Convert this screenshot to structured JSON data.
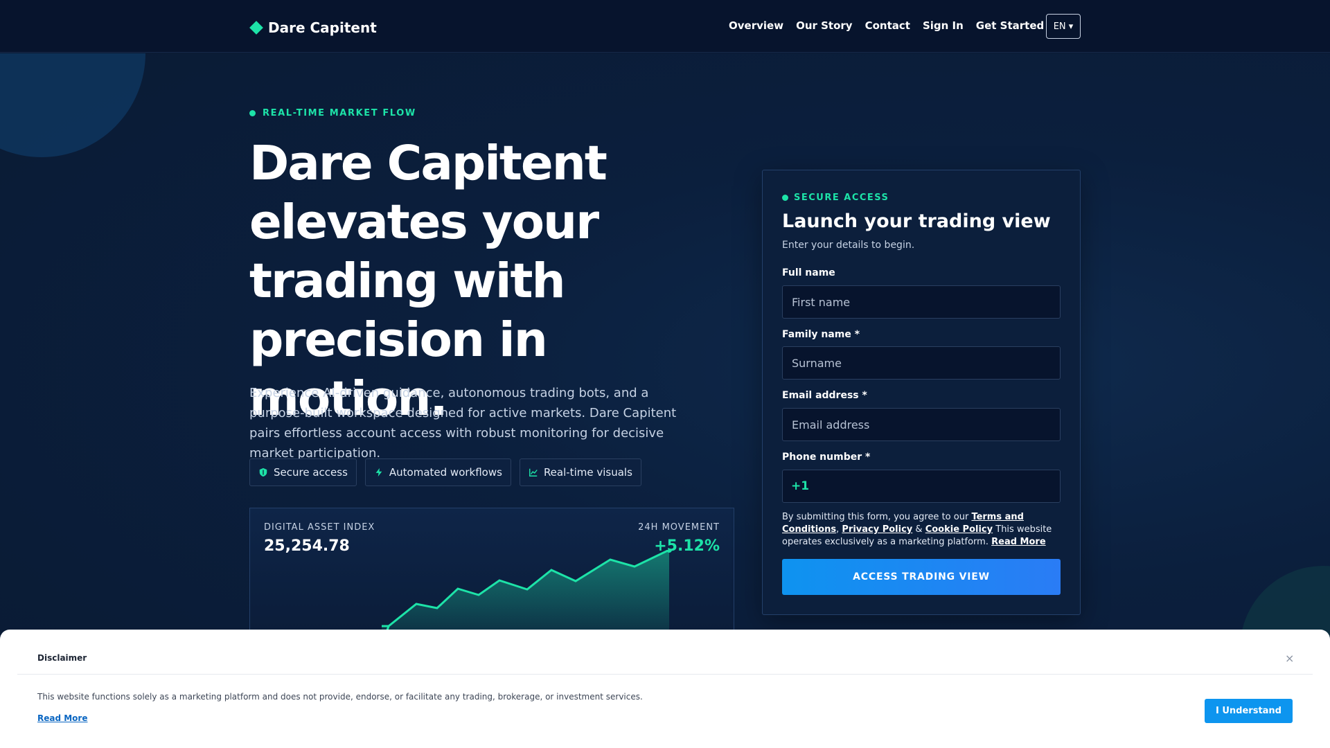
{
  "nav": {
    "brand": "Dare Capitent",
    "links": [
      "Overview",
      "Our Story",
      "Contact",
      "Sign In",
      "Get Started"
    ],
    "language": "EN ▾"
  },
  "hero": {
    "eyebrow": "REAL-TIME MARKET FLOW",
    "headline": "Dare Capitent elevates your trading with precision in motion.",
    "lead": "Experience AI-driven guidance, autonomous trading bots, and a purpose-built workspace designed for active markets. Dare Capitent pairs effortless account access with robust monitoring for decisive market participation.",
    "chips": [
      "Secure access",
      "Automated workflows",
      "Real-time visuals"
    ]
  },
  "index_card": {
    "label": "DIGITAL ASSET INDEX",
    "value": "25,254.78",
    "movement_label": "24H MOVEMENT",
    "movement_value": "+5.12%",
    "accent": "#1de3a8"
  },
  "form": {
    "eyebrow": "SECURE ACCESS",
    "title": "Launch your trading view",
    "subtitle": "Enter your details to begin.",
    "full_name_label": "Full name",
    "full_name_placeholder": "First name",
    "family_name_label": "Family name *",
    "family_name_placeholder": "Surname",
    "email_label": "Email address *",
    "email_placeholder": "Email address",
    "phone_label": "Phone number *",
    "phone_code": "+1",
    "legal_prefix": "By submitting this form, you agree to our",
    "terms": "Terms and Conditions",
    "comma": ",",
    "privacy": "Privacy Policy",
    "amp": "&",
    "cookie": "Cookie Policy",
    "legal_suffix": "This website operates exclusively as a marketing platform.",
    "read_more": "Read More",
    "submit": "ACCESS TRADING VIEW"
  },
  "disclaimer": {
    "title": "Disclaimer",
    "close": "×",
    "text": "This website functions solely as a marketing platform and does not provide, endorse, or facilitate any trading, brokerage, or investment services.",
    "read_more": "Read More",
    "button": "I Understand"
  },
  "colors": {
    "background": "#0a1a33",
    "accent": "#1de3a8",
    "primary_button": "#0e93f0"
  }
}
